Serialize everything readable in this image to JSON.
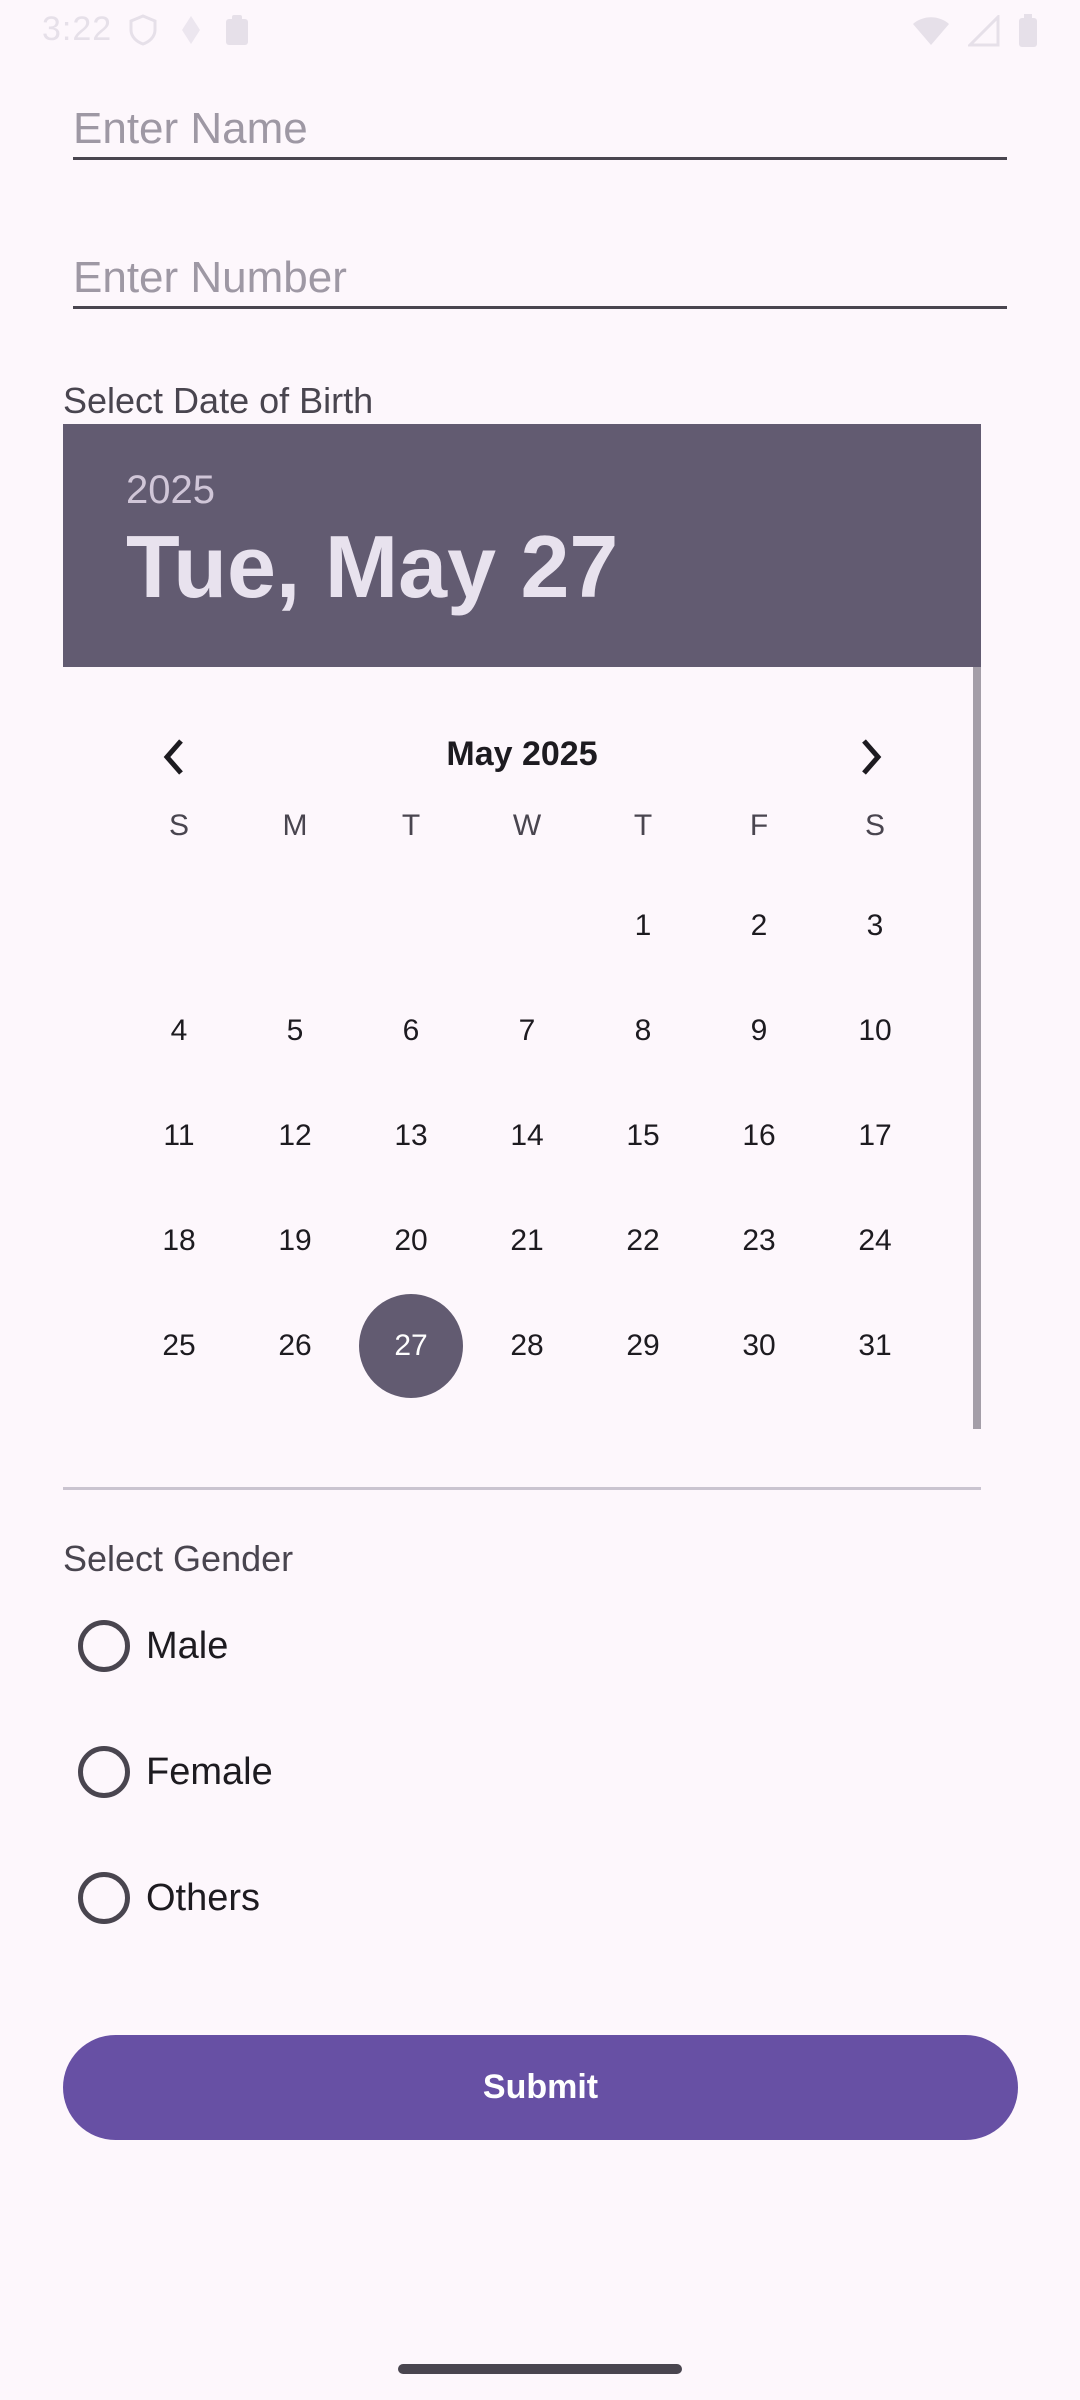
{
  "status_bar": {
    "time": "3:22",
    "icons": [
      "shield-icon",
      "navigation-icon",
      "clipboard-icon",
      "wifi-icon",
      "signal-icon",
      "battery-icon"
    ]
  },
  "form": {
    "name_placeholder": "Enter Name",
    "name_value": "",
    "number_placeholder": "Enter Number",
    "number_value": "",
    "dob_label": "Select Date of Birth",
    "gender_label": "Select Gender",
    "gender_options": [
      "Male",
      "Female",
      "Others"
    ],
    "submit_label": "Submit"
  },
  "date_picker": {
    "header_year": "2025",
    "header_date": "Tue, May 27",
    "month_label": "May 2025",
    "weekdays": [
      "S",
      "M",
      "T",
      "W",
      "T",
      "F",
      "S"
    ],
    "first_weekday_index": 4,
    "days_in_month": 31,
    "selected_day": 27
  },
  "colors": {
    "background": "#fdf7fc",
    "picker_header": "#625b71",
    "selected_day": "#625b71",
    "submit_button": "#6750a4"
  }
}
